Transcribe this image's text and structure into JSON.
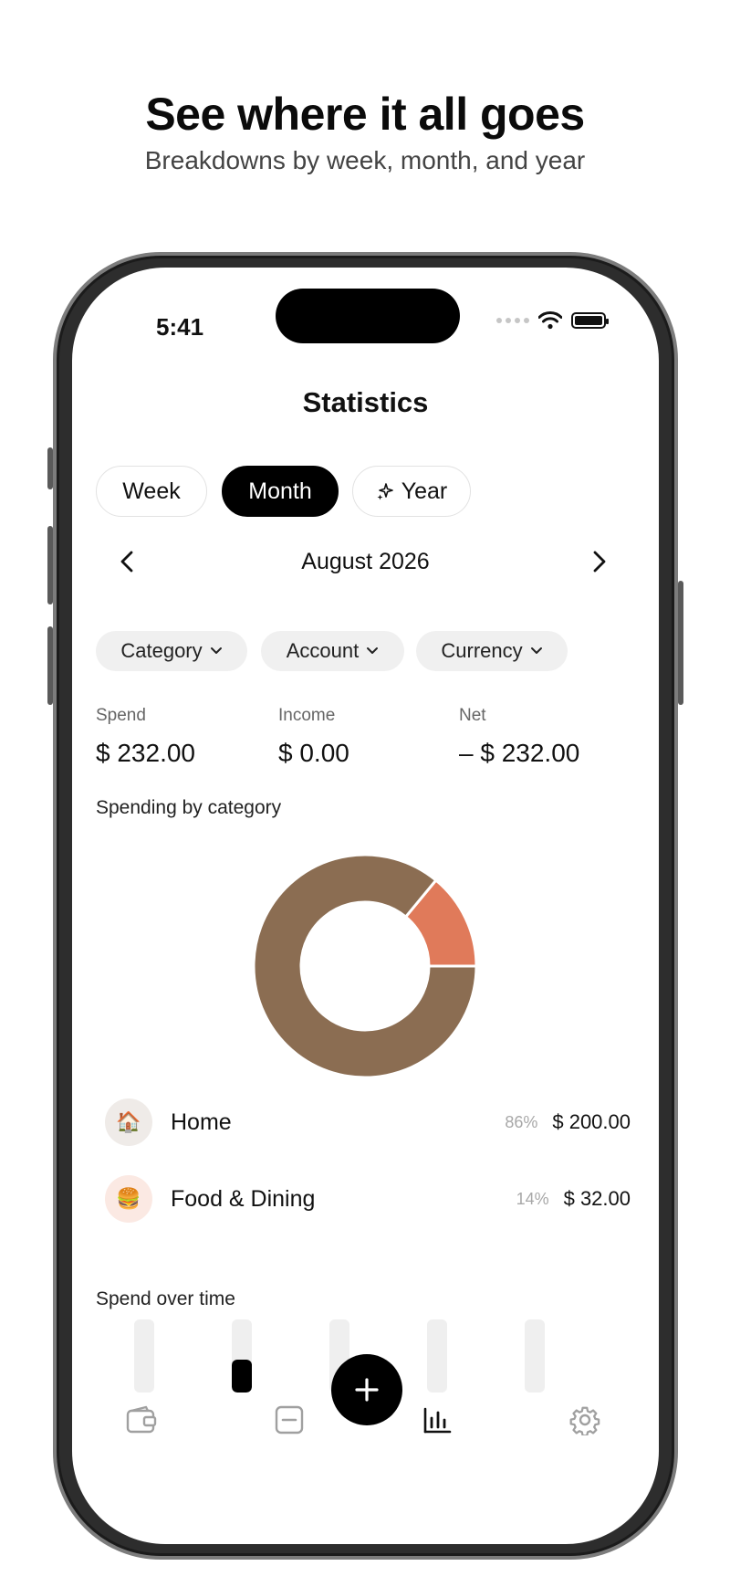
{
  "headline": "See where it all goes",
  "subheadline": "Breakdowns by week, month, and year",
  "status_bar": {
    "time": "5:41",
    "icons": [
      "cellular-dots-icon",
      "wifi-icon",
      "battery-icon"
    ]
  },
  "screen": {
    "title": "Statistics",
    "period_tabs": [
      {
        "label": "Week",
        "active": false
      },
      {
        "label": "Month",
        "active": true
      },
      {
        "label": "Year",
        "active": false,
        "icon": "sparkle-icon"
      }
    ],
    "period": {
      "label": "August 2026",
      "prev_icon": "chevron-left-icon",
      "next_icon": "chevron-right-icon"
    },
    "filters": [
      {
        "label": "Category",
        "icon": "chevron-down-icon"
      },
      {
        "label": "Account",
        "icon": "chevron-down-icon"
      },
      {
        "label": "Currency",
        "icon": "chevron-down-icon"
      }
    ],
    "metrics": {
      "spend": {
        "label": "Spend",
        "value": "$ 232.00"
      },
      "income": {
        "label": "Income",
        "value": "$ 0.00"
      },
      "net": {
        "label": "Net",
        "value": "– $ 232.00"
      }
    },
    "spending_by_category": {
      "label": "Spending by category",
      "categories": [
        {
          "name": "Home",
          "emoji": "🏠",
          "percent_label": "86%",
          "amount": "$ 200.00",
          "color": "#8B6D52",
          "icon_bg": "#efebe8"
        },
        {
          "name": "Food & Dining",
          "emoji": "🍔",
          "percent_label": "14%",
          "amount": "$ 32.00",
          "color": "#E07A5A",
          "icon_bg": "#fbe9e3"
        }
      ]
    },
    "spend_over_time": {
      "label": "Spend over time",
      "levels": [
        0,
        0.45,
        0,
        0,
        0
      ]
    },
    "tab_bar": {
      "items": [
        "wallet-icon",
        "minus-square-icon",
        "bar-chart-icon",
        "gear-icon"
      ],
      "active": "bar-chart-icon",
      "fab_icon": "plus-icon"
    }
  },
  "colors": {
    "accent": "#000000",
    "home": "#8B6D52",
    "food": "#E07A5A",
    "inactive_icon": "#a0a0a0"
  }
}
